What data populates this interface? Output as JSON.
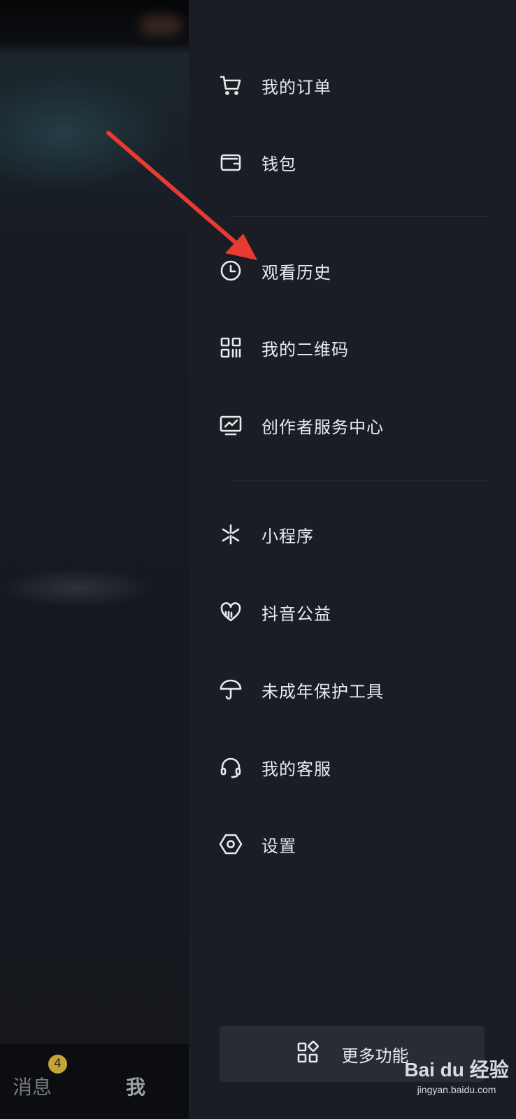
{
  "menu": [
    {
      "label": "我的订单",
      "icon": "cart-icon"
    },
    {
      "label": "钱包",
      "icon": "wallet-icon"
    },
    {
      "label": "观看历史",
      "icon": "clock-icon"
    },
    {
      "label": "我的二维码",
      "icon": "qr-code-icon"
    },
    {
      "label": "创作者服务中心",
      "icon": "monitor-chart-icon"
    },
    {
      "label": "小程序",
      "icon": "mini-program-icon"
    },
    {
      "label": "抖音公益",
      "icon": "heart-hands-icon"
    },
    {
      "label": "未成年保护工具",
      "icon": "umbrella-icon"
    },
    {
      "label": "我的客服",
      "icon": "headset-icon"
    },
    {
      "label": "设置",
      "icon": "hexagon-settings-icon"
    }
  ],
  "more_button": {
    "label": "更多功能",
    "icon": "grid-apps-icon"
  },
  "bottom_nav": {
    "messages_label": "消息",
    "messages_badge": "4",
    "me_label": "我"
  },
  "watermark": {
    "brand": "Bai du 经验",
    "url": "jingyan.baidu.com"
  },
  "colors": {
    "drawer_bg": "#1b1d25",
    "badge": "#c7a438",
    "annotation_arrow": "#e83a32"
  }
}
